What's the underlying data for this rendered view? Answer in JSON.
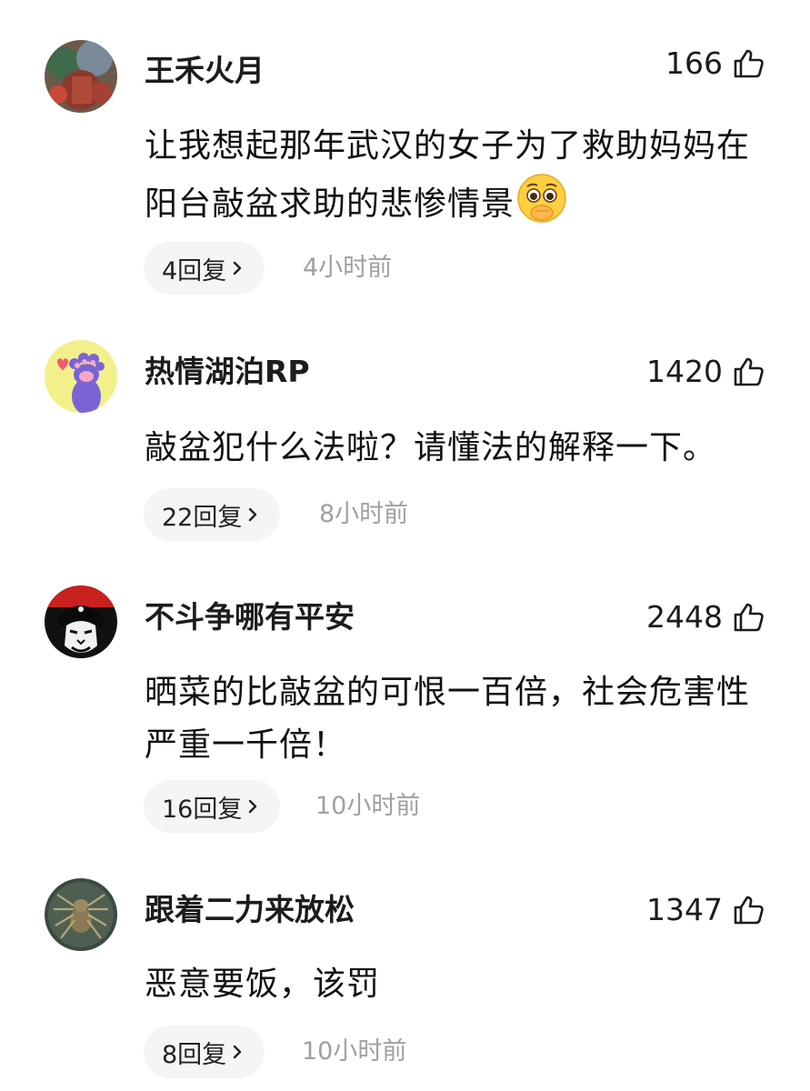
{
  "comments": [
    {
      "username": "王禾火月",
      "likes": "166",
      "text": "让我想起那年武汉的女子为了救助妈妈在阳台敲盆求助的悲惨情景",
      "emoji": "pleading-face-emoji",
      "replies": "4回复",
      "time": "4小时前"
    },
    {
      "username": "热情湖泊RP",
      "likes": "1420",
      "text": "敲盆犯什么法啦？请懂法的解释一下。",
      "replies": "22回复",
      "time": "8小时前"
    },
    {
      "username": "不斗争哪有平安",
      "likes": "2448",
      "text": "晒菜的比敲盆的可恨一百倍，社会危害性严重一千倍！",
      "replies": "16回复",
      "time": "10小时前"
    },
    {
      "username": "跟着二力来放松",
      "likes": "1347",
      "text": "恶意要饭，该罚",
      "replies": "8回复",
      "time": "10小时前"
    }
  ],
  "icons": {
    "like": "thumbs-up-icon",
    "chevron": "chevron-right-icon"
  },
  "colors": {
    "reply_bg": "#f5f5f5",
    "time_text": "#a0a0a0"
  }
}
